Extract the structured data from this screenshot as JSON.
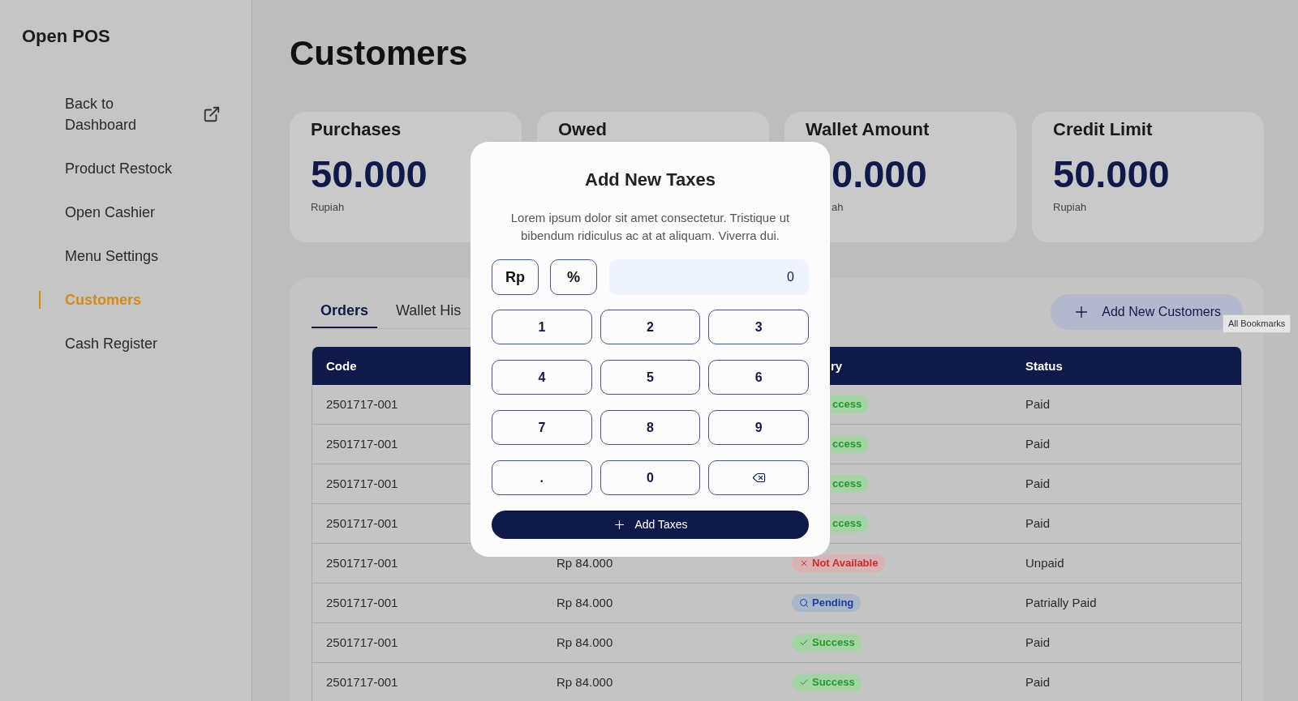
{
  "sidebar": {
    "brand": "Open POS",
    "items": [
      {
        "label": "Back to Dashboard",
        "selected": false,
        "external": true
      },
      {
        "label": "Product Restock",
        "selected": false,
        "external": false
      },
      {
        "label": "Open Cashier",
        "selected": false,
        "external": false
      },
      {
        "label": "Menu Settings",
        "selected": false,
        "external": false
      },
      {
        "label": "Customers",
        "selected": true,
        "external": false
      },
      {
        "label": "Cash Register",
        "selected": false,
        "external": false
      }
    ]
  },
  "page_title": "Customers",
  "cards": [
    {
      "title": "Purchases",
      "value": "50.000",
      "unit": "Rupiah",
      "partial": false
    },
    {
      "title": "Owed"
    },
    {
      "title": "Wallet Amount",
      "value": "0.000",
      "unit": "ah",
      "partial": true
    },
    {
      "title": "Credit Limit",
      "value": "50.000",
      "unit": "Rupiah",
      "partial": false
    }
  ],
  "tabs": [
    {
      "label": "Orders",
      "selected": true
    },
    {
      "label": "Wallet His",
      "selected": false
    }
  ],
  "add_button": "Add New Customers",
  "tooltip": "All Bookmarks",
  "table": {
    "columns": [
      {
        "label": "Code"
      },
      {},
      {
        "label": "ry"
      },
      {
        "label": "Status"
      }
    ],
    "rows": [
      {
        "code": "2501717-001",
        "badge": {
          "kind": "success",
          "label": "ccess",
          "partial": true
        },
        "status": "Paid"
      },
      {
        "code": "2501717-001",
        "badge": {
          "kind": "success",
          "label": "ccess",
          "partial": true
        },
        "status": "Paid"
      },
      {
        "code": "2501717-001",
        "badge": {
          "kind": "success",
          "label": "ccess",
          "partial": true
        },
        "status": "Paid"
      },
      {
        "code": "2501717-001",
        "badge": {
          "kind": "success",
          "label": "ccess",
          "partial": true
        },
        "status": "Paid"
      },
      {
        "code": "2501717-001",
        "amount": "Rp 84.000",
        "badge": {
          "kind": "error",
          "label": "Not Available",
          "partial": false
        },
        "status": "Unpaid"
      },
      {
        "code": "2501717-001",
        "amount": "Rp 84.000",
        "badge": {
          "kind": "pending",
          "label": "Pending",
          "partial": false
        },
        "status": "Patrially Paid"
      },
      {
        "code": "2501717-001",
        "amount": "Rp 84.000",
        "badge": {
          "kind": "success",
          "label": "Success",
          "partial": false
        },
        "status": "Paid"
      },
      {
        "code": "2501717-001",
        "amount": "Rp 84.000",
        "badge": {
          "kind": "success",
          "label": "Success",
          "partial": false
        },
        "status": "Paid"
      }
    ]
  },
  "modal": {
    "title": "Add New Taxes",
    "description": "Lorem ipsum dolor sit amet consectetur. Tristique ut bibendum ridiculus ac at at aliquam. Viverra dui.",
    "units": [
      "Rp",
      "%"
    ],
    "input_value": "0",
    "keys": [
      {
        "kind": "digit",
        "label": "1"
      },
      {
        "kind": "digit",
        "label": "2"
      },
      {
        "kind": "digit",
        "label": "3"
      },
      {
        "kind": "digit",
        "label": "4"
      },
      {
        "kind": "digit",
        "label": "5"
      },
      {
        "kind": "digit",
        "label": "6"
      },
      {
        "kind": "digit",
        "label": "7"
      },
      {
        "kind": "digit",
        "label": "8"
      },
      {
        "kind": "digit",
        "label": "9"
      },
      {
        "kind": "digit",
        "label": "."
      },
      {
        "kind": "digit",
        "label": "0"
      },
      {
        "kind": "backspace"
      }
    ],
    "submit": "Add Taxes"
  }
}
